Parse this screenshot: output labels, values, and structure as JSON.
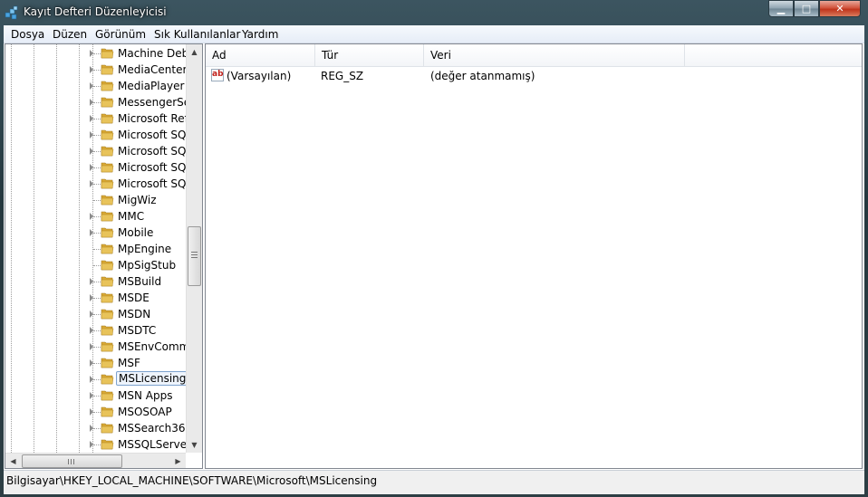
{
  "window": {
    "title": "Kayıt Defteri Düzenleyicisi",
    "buttons": {
      "minimize": "▁",
      "maximize": "□",
      "close": "✕"
    }
  },
  "menu": [
    "Dosya",
    "Düzen",
    "Görünüm",
    "Sık Kullanılanlar",
    "Yardım"
  ],
  "tree": {
    "items": [
      {
        "label": "Machine Debu",
        "expandable": true
      },
      {
        "label": "MediaCenterP",
        "expandable": true
      },
      {
        "label": "MediaPlayer",
        "expandable": true
      },
      {
        "label": "MessengerServ",
        "expandable": true
      },
      {
        "label": "Microsoft Refe",
        "expandable": true
      },
      {
        "label": "Microsoft SQL",
        "expandable": true
      },
      {
        "label": "Microsoft SQL",
        "expandable": true
      },
      {
        "label": "Microsoft SQL",
        "expandable": true
      },
      {
        "label": "Microsoft SQL",
        "expandable": true
      },
      {
        "label": "MigWiz",
        "expandable": false
      },
      {
        "label": "MMC",
        "expandable": true
      },
      {
        "label": "Mobile",
        "expandable": true
      },
      {
        "label": "MpEngine",
        "expandable": false
      },
      {
        "label": "MpSigStub",
        "expandable": false
      },
      {
        "label": "MSBuild",
        "expandable": true
      },
      {
        "label": "MSDE",
        "expandable": true
      },
      {
        "label": "MSDN",
        "expandable": true
      },
      {
        "label": "MSDTC",
        "expandable": true
      },
      {
        "label": "MSEnvCommu",
        "expandable": true
      },
      {
        "label": "MSF",
        "expandable": true
      },
      {
        "label": "MSLicensing",
        "expandable": true,
        "selected": true
      },
      {
        "label": "MSN Apps",
        "expandable": true
      },
      {
        "label": "MSOSOAP",
        "expandable": true
      },
      {
        "label": "MSSearch36",
        "expandable": true
      },
      {
        "label": "MSSQLServer",
        "expandable": true
      }
    ],
    "scroll": {
      "up_arrow": "▲",
      "down_arrow": "▼",
      "left_arrow": "◀",
      "right_arrow": "▶"
    }
  },
  "list": {
    "columns": [
      "Ad",
      "Tür",
      "Veri"
    ],
    "rows": [
      {
        "icon": "ab",
        "name": "(Varsayılan)",
        "type": "REG_SZ",
        "data": "(değer atanmamış)"
      }
    ]
  },
  "status": {
    "path": "Bilgisayar\\HKEY_LOCAL_MACHINE\\SOFTWARE\\Microsoft\\MSLicensing"
  },
  "colors": {
    "folder": "#e8c35a",
    "selection_border": "#7da2ce",
    "window_frame": "#2d3e44"
  }
}
